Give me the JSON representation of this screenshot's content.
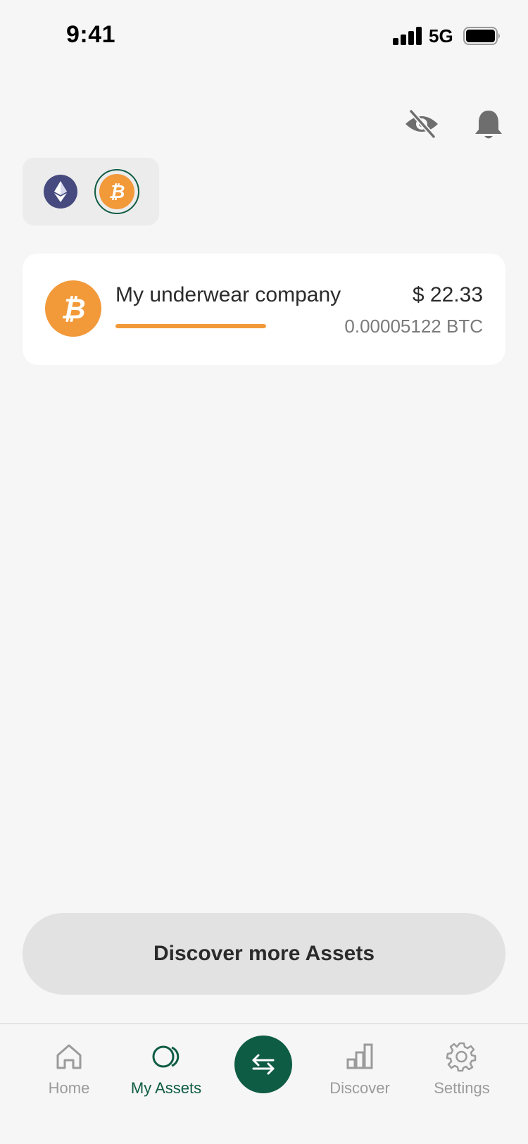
{
  "status_bar": {
    "time": "9:41",
    "network": "5G"
  },
  "header": {
    "hide_balance_icon": "eye-off-icon",
    "notifications_icon": "bell-icon"
  },
  "chain_selector": {
    "chains": [
      {
        "icon": "ethereum-icon",
        "selected": false
      },
      {
        "icon": "bitcoin-icon",
        "selected": true
      }
    ]
  },
  "assets": [
    {
      "icon": "bitcoin-icon",
      "name": "My underwear company",
      "usd_value": "$ 22.33",
      "crypto_value": "0.00005122 BTC",
      "allocation_fraction": 1.0
    }
  ],
  "discover_button": {
    "label": "Discover more Assets"
  },
  "bottom_nav": {
    "items": [
      {
        "label": "Home",
        "icon": "home-icon",
        "active": false
      },
      {
        "label": "My Assets",
        "icon": "assets-icon",
        "active": true
      },
      {
        "label": "Discover",
        "icon": "bar-chart-icon",
        "active": false
      },
      {
        "label": "Settings",
        "icon": "gear-icon",
        "active": false
      }
    ],
    "swap_icon": "swap-arrows-icon"
  },
  "colors": {
    "brand_green": "#0f5c44",
    "bitcoin_orange": "#f2993a",
    "ethereum_purple": "#464a7e",
    "background": "#f6f6f6"
  }
}
